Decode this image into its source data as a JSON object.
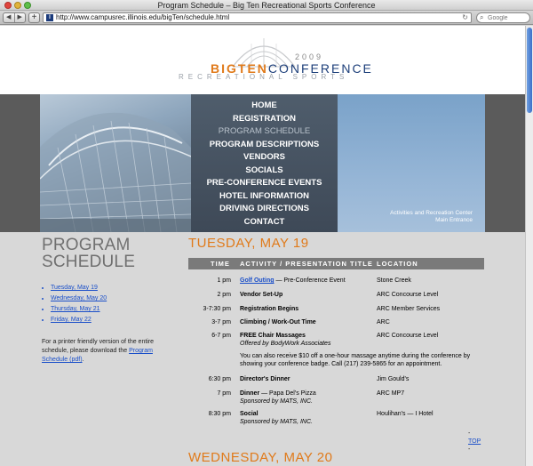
{
  "window": {
    "title": "Program Schedule – Big Ten Recreational Sports Conference",
    "url": "http://www.campusrec.illinois.edu/bigTen/schedule.html",
    "search_placeholder": "Google"
  },
  "logo": {
    "year": "2009",
    "main_big": "BIGTEN",
    "main_conf": "CONFERENCE",
    "sub": "RECREATIONAL SPORTS"
  },
  "nav": {
    "items": [
      {
        "label": "HOME"
      },
      {
        "label": "REGISTRATION"
      },
      {
        "label": "PROGRAM SCHEDULE"
      },
      {
        "label": "PROGRAM DESCRIPTIONS"
      },
      {
        "label": "VENDORS"
      },
      {
        "label": "SOCIALS"
      },
      {
        "label": "PRE-CONFERENCE EVENTS"
      },
      {
        "label": "HOTEL INFORMATION"
      },
      {
        "label": "DRIVING DIRECTIONS"
      },
      {
        "label": "CONTACT"
      }
    ],
    "active": "PROGRAM SCHEDULE"
  },
  "banner": {
    "caption_line1": "Activities and Recreation Center",
    "caption_line2": "Main Entrance"
  },
  "left": {
    "title_line1": "PROGRAM",
    "title_line2": "SCHEDULE",
    "day_links": [
      "Tuesday, May 19",
      "Wednesday, May 20",
      "Thursday, May 21",
      "Friday, May 22"
    ],
    "printer_text": "For a printer friendly version of the entire schedule, please download the",
    "printer_link": "Program Schedule (pdf)",
    "printer_end": "."
  },
  "schedule": {
    "day1_title": "TUESDAY, MAY 19",
    "headers": {
      "time": "TIME",
      "activity": "ACTIVITY / PRESENTATION TITLE",
      "location": "LOCATION"
    },
    "rows": {
      "r1": {
        "time": "1 pm",
        "link": "Golf Outing",
        "rest": " — Pre-Conference Event",
        "location": "Stone Creek"
      },
      "r2": {
        "time": "2 pm",
        "title": "Vendor Set-Up",
        "location": "ARC Concourse Level"
      },
      "r3": {
        "time": "3-7:30 pm",
        "title": "Registration Begins",
        "location": "ARC Member Services"
      },
      "r4": {
        "time": "3-7 pm",
        "title": "Climbing / Work-Out Time",
        "location": "ARC"
      },
      "r5": {
        "time": "6-7 pm",
        "title": "FREE Chair Massages",
        "sub": "Offered by BodyWork Associates",
        "location": "ARC Concourse Level"
      },
      "r5_note": "You can also receive $10 off a one-hour massage anytime during the conference by showing your conference badge. Call (217) 239-5865 for an appointment.",
      "r6": {
        "time": "6:30 pm",
        "title": "Director's Dinner",
        "location": "Jim Gould's"
      },
      "r7": {
        "time": "7 pm",
        "title": "Dinner",
        "rest": " — Papa Del's Pizza",
        "sub": "Sponsored by MATS, INC.",
        "location": "ARC MP7"
      },
      "r8": {
        "time": "8:30 pm",
        "title": "Social",
        "sub": "Sponsored by MATS, INC.",
        "location": "Houlihan's — I Hotel"
      }
    },
    "top_prefix": "- ",
    "top_label": "TOP",
    "top_suffix": " -",
    "day2_title": "WEDNESDAY, MAY 20"
  }
}
